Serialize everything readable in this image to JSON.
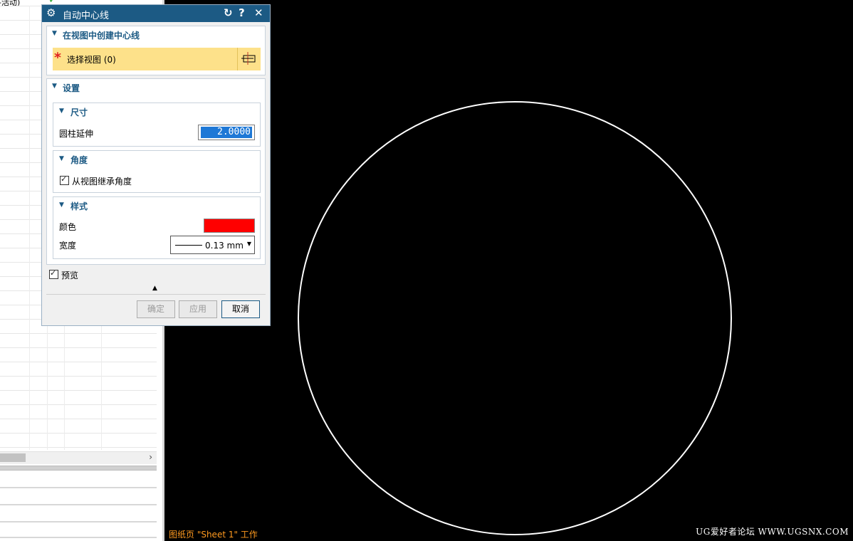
{
  "navigator": {
    "top_text": "-活动)"
  },
  "dialog": {
    "title": "自动中心线",
    "section_create": {
      "title": "在视图中创建中心线",
      "select_label": "选择视图 (0)"
    },
    "section_settings": {
      "title": "设置",
      "size": {
        "title": "尺寸",
        "cylinder_extension_label": "圆柱延伸",
        "cylinder_extension_value": "2.0000"
      },
      "angle": {
        "title": "角度",
        "inherit_label": "从视图继承角度",
        "inherit_checked": true
      },
      "style": {
        "title": "样式",
        "color_label": "颜色",
        "color_value": "#ff0000",
        "width_label": "宽度",
        "width_value": "0.13 mm"
      }
    },
    "preview_label": "预览",
    "preview_checked": true,
    "buttons": {
      "ok": "确定",
      "apply": "应用",
      "cancel": "取消"
    }
  },
  "status": {
    "sheet": "图纸页 \"Sheet 1\" 工作"
  },
  "watermark": "UG爱好者论坛 WWW.UGSNX.COM",
  "colors": {
    "title_bar": "#1c5a84",
    "selection_highlight": "#fde18a",
    "status_text": "#ff9a1f"
  }
}
